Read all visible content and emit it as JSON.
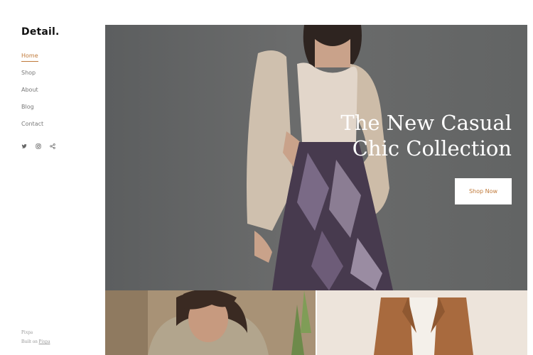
{
  "brand": {
    "logo": "Detail."
  },
  "nav": {
    "items": [
      {
        "label": "Home",
        "active": true
      },
      {
        "label": "Shop",
        "active": false
      },
      {
        "label": "About",
        "active": false
      },
      {
        "label": "Blog",
        "active": false
      },
      {
        "label": "Contact",
        "active": false
      }
    ]
  },
  "social": [
    "twitter-icon",
    "instagram-icon",
    "share-icon"
  ],
  "footer": {
    "line1": "Pixpa",
    "built_prefix": "Built on ",
    "built_link": "Pixpa"
  },
  "hero": {
    "title_line1": "The New Casual",
    "title_line2": "Chic Collection",
    "button_label": "Shop Now"
  },
  "colors": {
    "accent": "#c07a3a",
    "hero_bg": "#6a6b6b"
  }
}
